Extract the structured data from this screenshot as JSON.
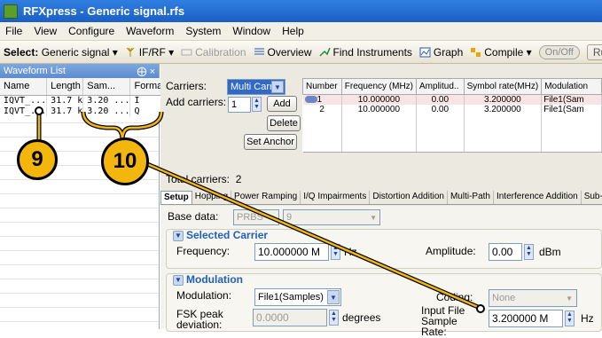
{
  "window": {
    "title": "RFXpress - Generic signal.rfs"
  },
  "menu": [
    "File",
    "View",
    "Configure",
    "Waveform",
    "System",
    "Window",
    "Help"
  ],
  "toolbar": {
    "select_label": "Select:",
    "select_value": "Generic signal",
    "ifrf": "IF/RF",
    "calibration": "Calibration",
    "overview": "Overview",
    "find": "Find Instruments",
    "graph": "Graph",
    "compile": "Compile",
    "onoff": "On/Off",
    "run": "Run"
  },
  "waveform_list": {
    "title": "Waveform List",
    "pin": "⨁ ×",
    "columns": [
      "Name",
      "Length",
      "Sam...",
      "Forma"
    ],
    "rows": [
      [
        "IQVT_...",
        "31.7 k",
        "3.20 ...",
        "I"
      ],
      [
        "IQVT_...",
        "31.7 k",
        "3.20 ...",
        "Q"
      ]
    ]
  },
  "carriers": {
    "label": "Carriers:",
    "mode": "Multi Carrier",
    "add_label": "Add carriers:",
    "add_count": "1",
    "add_button": "Add",
    "delete_button": "Delete",
    "set_anchor_button": "Set Anchor",
    "total_label": "Total carriers:",
    "total_value": "2",
    "table": {
      "columns": [
        "Number",
        "Frequency (MHz)",
        "Amplitud..",
        "Symbol rate(MHz)",
        "Modulation"
      ],
      "rows": [
        [
          "1",
          "10.000000",
          "0.00",
          "3.200000",
          "File1(Sam"
        ],
        [
          "2",
          "10.000000",
          "0.00",
          "3.200000",
          "File1(Sam"
        ]
      ]
    }
  },
  "tabs": [
    "Setup",
    "Hopping",
    "Power Ramping",
    "I/Q Impairments",
    "Distortion Addition",
    "Multi-Path",
    "Interference Addition",
    "Sub-Carrie"
  ],
  "setup": {
    "base_data_label": "Base data:",
    "base_data_value": "PRBS",
    "base_data_order": "9",
    "selected_carrier_title": "Selected Carrier",
    "frequency_label": "Frequency:",
    "frequency_value": "10.000000 M",
    "frequency_unit": "Hz",
    "amplitude_label": "Amplitude:",
    "amplitude_value": "0.00",
    "amplitude_unit": "dBm",
    "modulation_title": "Modulation",
    "modulation_label": "Modulation:",
    "modulation_value": "File1(Samples)",
    "coding_label": "Coding:",
    "coding_value": "None",
    "fsk_label": "FSK peak deviation:",
    "fsk_value": "0.0000",
    "fsk_unit": "degrees",
    "sample_rate_label": "Input File Sample Rate:",
    "sample_rate_value": "3.200000 M",
    "sample_rate_unit": "Hz"
  },
  "callouts": {
    "c9": "9",
    "c10": "10"
  },
  "colors": {
    "callout_fill": "#f3b60d",
    "title_bar": "#1c5fc4",
    "accent_blue": "#1f5fbf"
  }
}
